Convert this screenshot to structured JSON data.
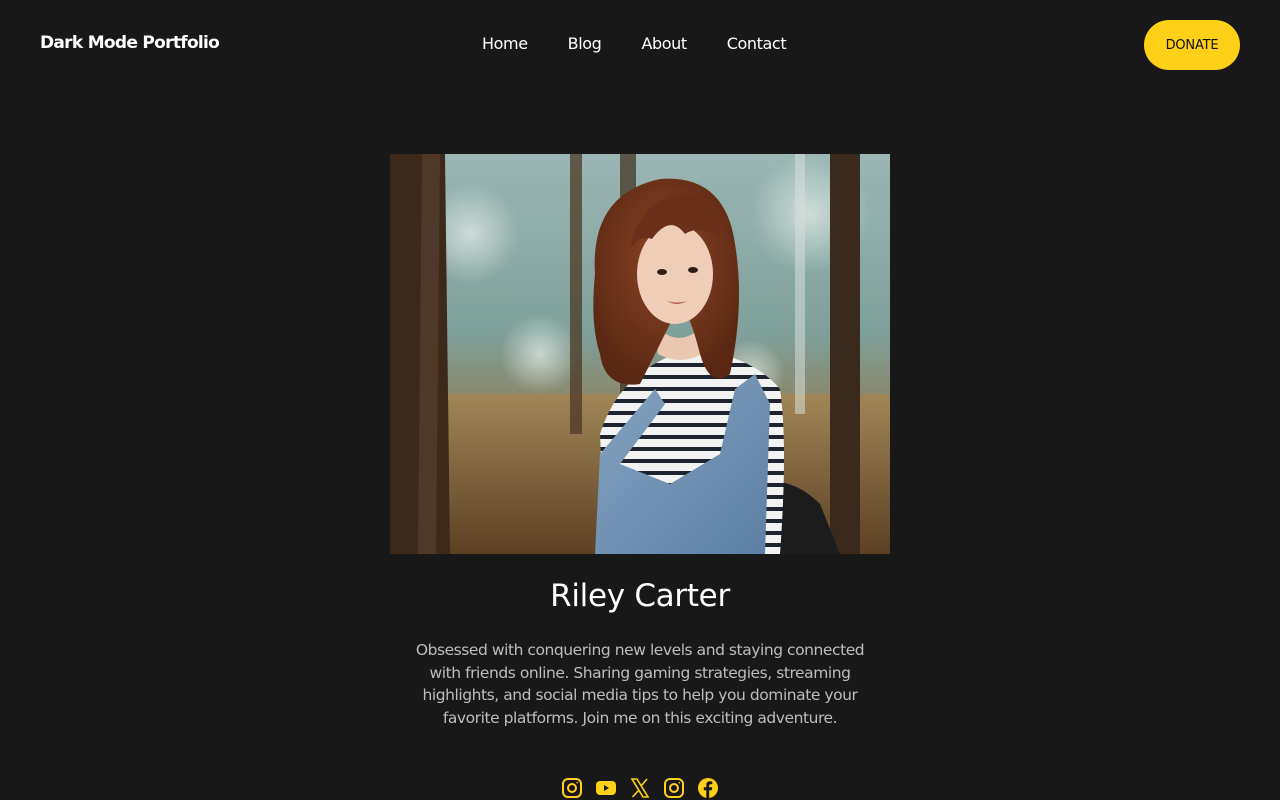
{
  "header": {
    "brand": "Dark Mode Portfolio",
    "nav": [
      {
        "label": "Home"
      },
      {
        "label": "Blog"
      },
      {
        "label": "About"
      },
      {
        "label": "Contact"
      }
    ],
    "donate_label": "DONATE"
  },
  "profile": {
    "photo_icon": "portrait-photo",
    "name": "Riley Carter",
    "bio": "Obsessed with conquering new levels and staying connected with friends online. Sharing gaming strategies, streaming highlights, and social media tips to help you dominate your favorite platforms. Join me on this exciting adventure."
  },
  "socials": [
    {
      "icon": "instagram-icon"
    },
    {
      "icon": "youtube-icon"
    },
    {
      "icon": "x-icon"
    },
    {
      "icon": "instagram-icon"
    },
    {
      "icon": "facebook-icon"
    }
  ],
  "colors": {
    "background": "#181818",
    "accent": "#ffd018",
    "text": "#ffffff",
    "muted_text": "#bdbdbd"
  }
}
